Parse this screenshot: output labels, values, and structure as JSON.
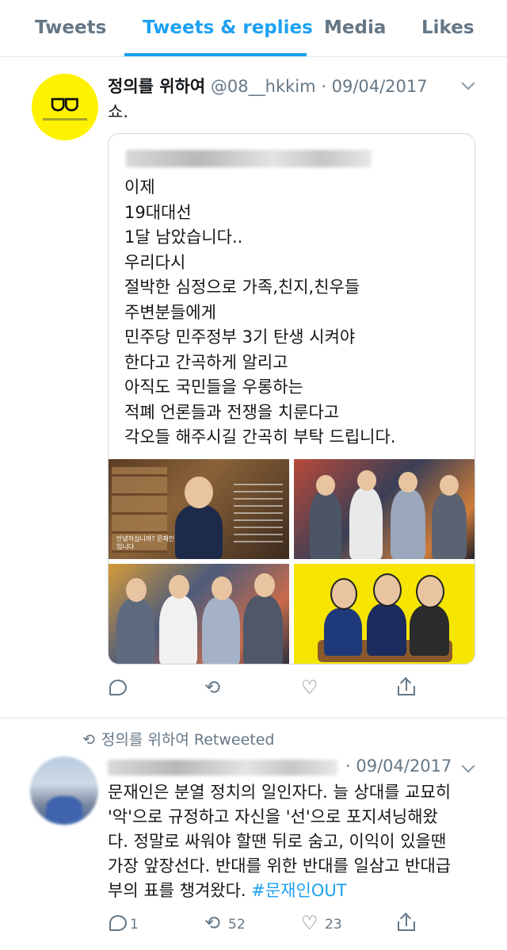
{
  "tabs": [
    {
      "label": "Tweets"
    },
    {
      "label": "Tweets & replies"
    },
    {
      "label": "Media"
    },
    {
      "label": "Likes"
    }
  ],
  "active_tab": "Tweets & replies",
  "tweet1": {
    "name": "정의를 위하여",
    "handle_date": "@08__hkkim · 09/04/2017",
    "text": "쇼.",
    "card_lines": [
      "이제",
      "19대대선",
      "1달 남았습니다..",
      "우리다시",
      "절박한 심정으로 가족,친지,친우들",
      "주변분들에게",
      "민주당 민주정부 3기 탄생 시켜야",
      "한다고 간곡하게 알리고",
      "아직도 국민들을 우롱하는",
      "적폐 언론들과 전쟁을 치룬다고",
      "각오들 해주시길 간곡히 부탁 드립니다."
    ],
    "image1_caption": "안녕하십니까? 문재인입니다"
  },
  "tweet2": {
    "retweet_label": "정의를 위하여 Retweeted",
    "date": "· 09/04/2017",
    "lines": [
      "문재인은 분열 정치의 일인자다. 늘 상대를 교묘히",
      "'악'으로 규정하고 자신을 '선'으로 포지셔닝해왔",
      "다. 정말로 싸워야 할땐 뒤로 숨고, 이익이 있을땐",
      "가장 앞장선다. 반대를 위한 반대를 일삼고 반대급"
    ],
    "last_line_text": "부의 표를 챙겨왔다. ",
    "hashtag": "#문재인OUT",
    "reply_count": "1",
    "retweet_count": "52",
    "like_count": "23"
  },
  "colors": {
    "accent": "#1da1f2",
    "muted": "#657786",
    "border": "#e1e8ed"
  }
}
